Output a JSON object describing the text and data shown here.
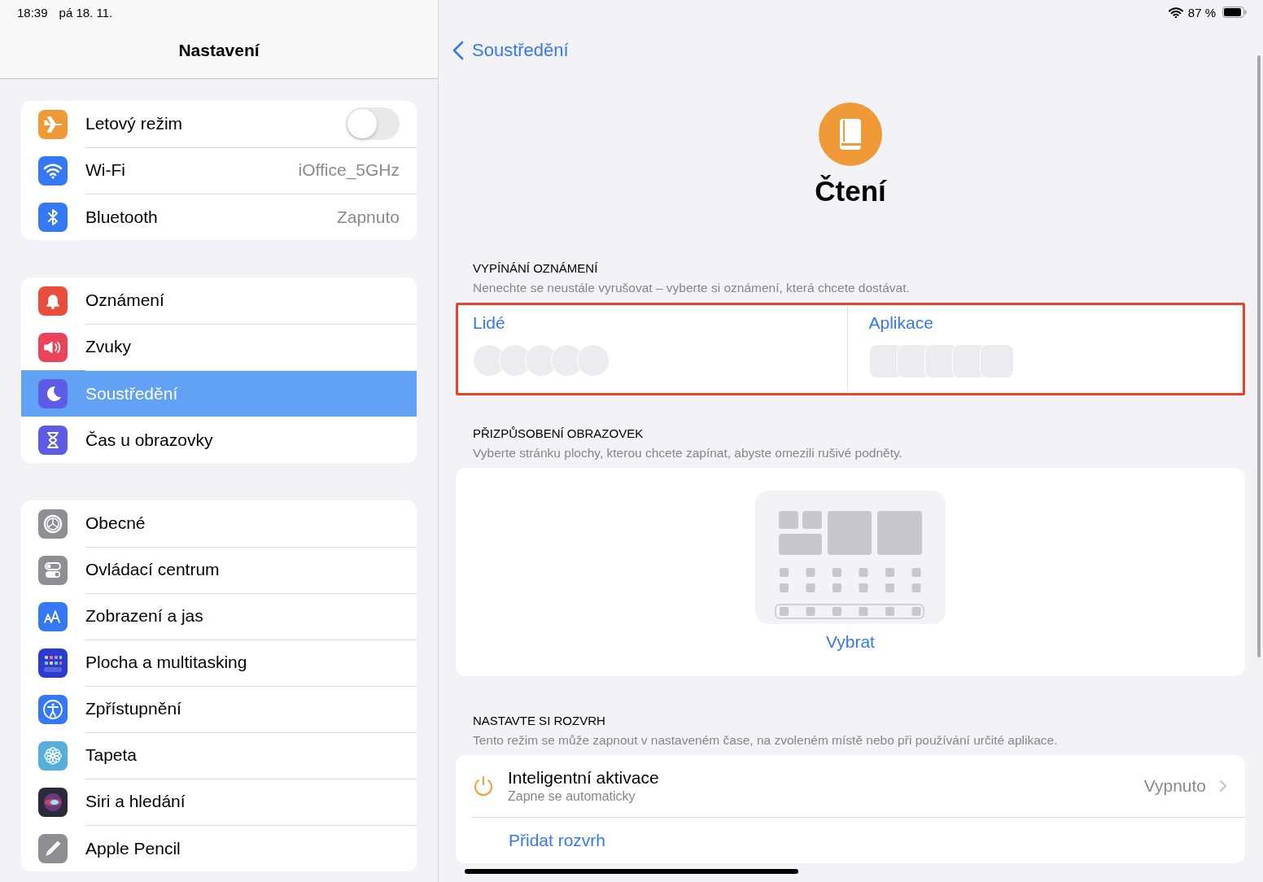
{
  "status_bar": {
    "time": "18:39",
    "date": "pá 18. 11.",
    "battery": "87 %"
  },
  "sidebar": {
    "title": "Nastavení",
    "groups": [
      {
        "items": [
          {
            "kind": "toggle",
            "label": "Letový režim",
            "color": "#f09a37",
            "on": false,
            "selected": false
          },
          {
            "kind": "value",
            "label": "Wi-Fi",
            "value": "iOffice_5GHz",
            "color": "#3478f6",
            "selected": false
          },
          {
            "kind": "value",
            "label": "Bluetooth",
            "value": "Zapnuto",
            "color": "#3478f6",
            "selected": false
          }
        ]
      },
      {
        "items": [
          {
            "kind": "plain",
            "label": "Oznámení",
            "color": "#eb4d3d",
            "selected": false
          },
          {
            "kind": "plain",
            "label": "Zvuky",
            "color": "#eb445a",
            "selected": false
          },
          {
            "kind": "plain",
            "label": "Soustředění",
            "color": "#5e5ce6",
            "selected": true
          },
          {
            "kind": "plain",
            "label": "Čas u obrazovky",
            "color": "#5e5ce6",
            "selected": false
          }
        ]
      },
      {
        "items": [
          {
            "kind": "plain",
            "label": "Obecné",
            "color": "#8e8e93",
            "selected": false
          },
          {
            "kind": "plain",
            "label": "Ovládací centrum",
            "color": "#8e8e93",
            "selected": false
          },
          {
            "kind": "plain",
            "label": "Zobrazení a jas",
            "color": "#3478f6",
            "selected": false
          },
          {
            "kind": "plain",
            "label": "Plocha a multitasking",
            "color": "#2a3bd0",
            "selected": false
          },
          {
            "kind": "plain",
            "label": "Zpřístupnění",
            "color": "#3478f6",
            "selected": false
          },
          {
            "kind": "plain",
            "label": "Tapeta",
            "color": "#55aedc",
            "selected": false
          },
          {
            "kind": "plain",
            "label": "Siri a hledání",
            "color": "#2a2a3a",
            "selected": false
          },
          {
            "kind": "plain",
            "label": "Apple Pencil",
            "color": "#8e8e93",
            "selected": false
          }
        ]
      }
    ]
  },
  "detail": {
    "back": "Soustředění",
    "title": "Čtení",
    "notifications": {
      "header": "VYPÍNÁNÍ OZNÁMENÍ",
      "description": "Nenechte se neustále vyrušovat – vyberte si oznámení, která chcete dostávat.",
      "highlighted": true,
      "people": "Lidé",
      "apps": "Aplikace"
    },
    "screens": {
      "header": "PŘIZPŮSOBENÍ OBRAZOVEK",
      "description": "Vyberte stránku plochy, kterou chcete zapínat, abyste omezili rušivé podněty.",
      "action": "Vybrat"
    },
    "schedule": {
      "header": "NASTAVTE SI ROZVRH",
      "description": "Tento režim se může zapnout v nastaveném čase, na zvoleném místě nebo při používání určité aplikace.",
      "smart": {
        "title": "Inteligentní aktivace",
        "subtitle": "Zapne se automaticky",
        "value": "Vypnuto"
      },
      "add": "Přidat rozvrh"
    }
  }
}
